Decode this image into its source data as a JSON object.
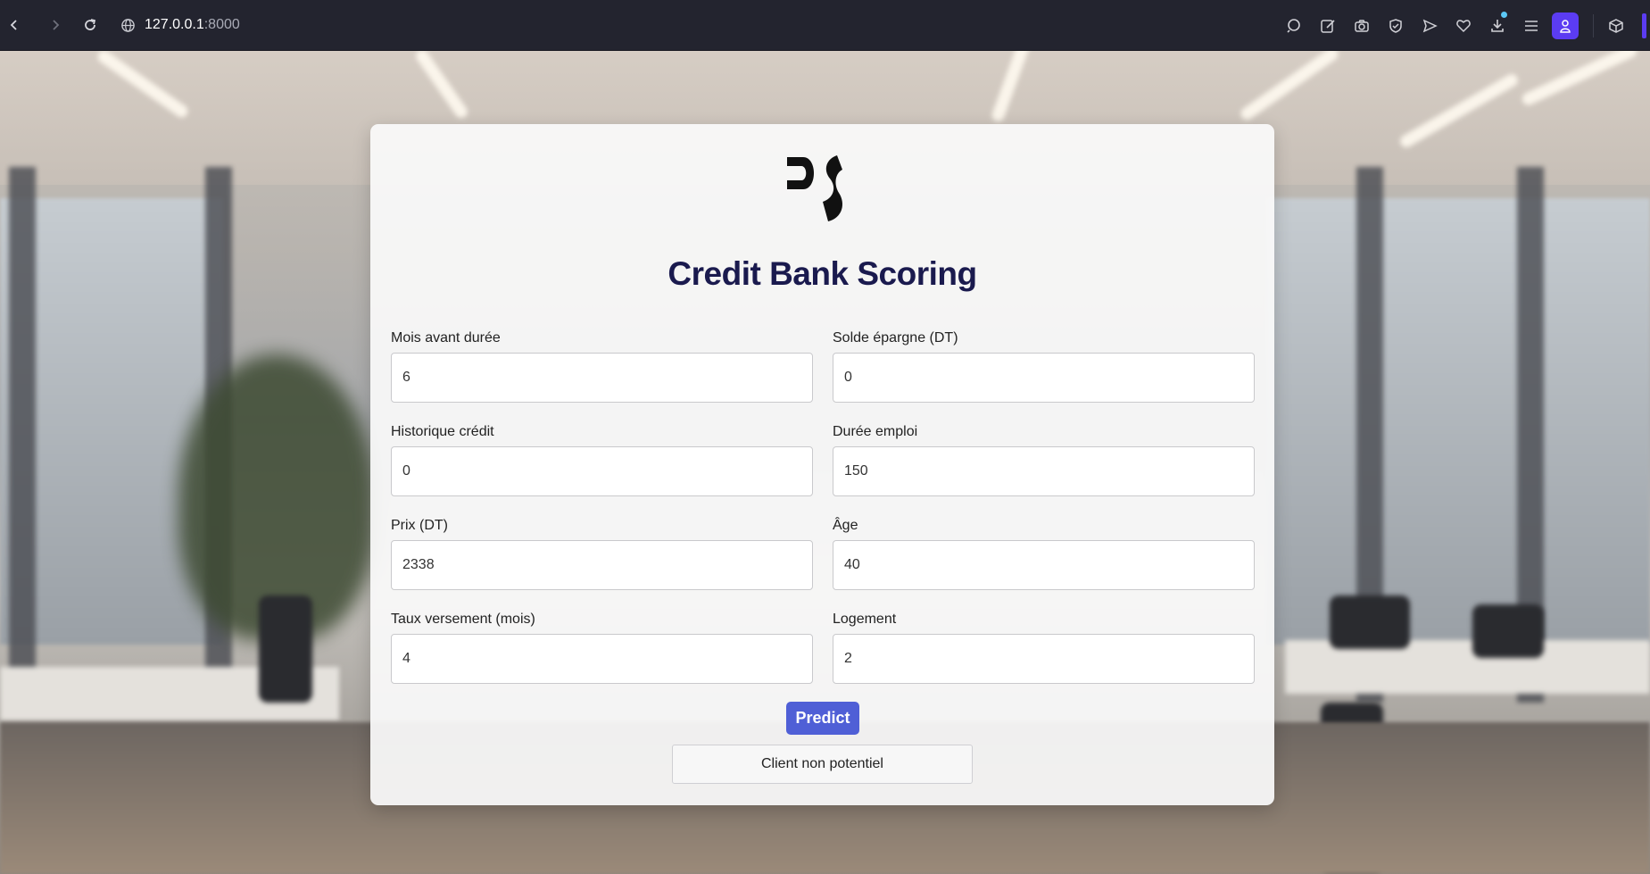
{
  "browser": {
    "url_host": "127.0.0.1",
    "url_port": ":8000"
  },
  "app": {
    "title": "Credit Bank Scoring",
    "logo_text": "DS"
  },
  "form": {
    "fields": [
      {
        "label": "Mois avant durée",
        "value": "6"
      },
      {
        "label": "Solde épargne (DT)",
        "value": "0"
      },
      {
        "label": "Historique crédit",
        "value": "0"
      },
      {
        "label": "Durée emploi",
        "value": "150"
      },
      {
        "label": "Prix (DT)",
        "value": "2338"
      },
      {
        "label": "Âge",
        "value": "40"
      },
      {
        "label": "Taux versement (mois)",
        "value": "4"
      },
      {
        "label": "Logement",
        "value": "2"
      }
    ],
    "submit_label": "Predict"
  },
  "result": {
    "text": "Client non potentiel"
  },
  "colors": {
    "accent": "#4f5fd6",
    "title": "#1a1a4e",
    "profile": "#5b3cf2"
  }
}
